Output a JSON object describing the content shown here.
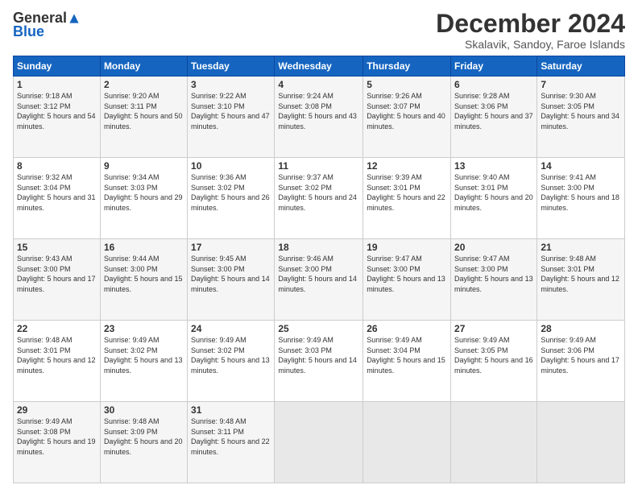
{
  "logo": {
    "general": "General",
    "blue": "Blue"
  },
  "title": "December 2024",
  "subtitle": "Skalavik, Sandoy, Faroe Islands",
  "days_of_week": [
    "Sunday",
    "Monday",
    "Tuesday",
    "Wednesday",
    "Thursday",
    "Friday",
    "Saturday"
  ],
  "weeks": [
    [
      {
        "day": "1",
        "sunrise": "9:18 AM",
        "sunset": "3:12 PM",
        "daylight": "5 hours and 54 minutes."
      },
      {
        "day": "2",
        "sunrise": "9:20 AM",
        "sunset": "3:11 PM",
        "daylight": "5 hours and 50 minutes."
      },
      {
        "day": "3",
        "sunrise": "9:22 AM",
        "sunset": "3:10 PM",
        "daylight": "5 hours and 47 minutes."
      },
      {
        "day": "4",
        "sunrise": "9:24 AM",
        "sunset": "3:08 PM",
        "daylight": "5 hours and 43 minutes."
      },
      {
        "day": "5",
        "sunrise": "9:26 AM",
        "sunset": "3:07 PM",
        "daylight": "5 hours and 40 minutes."
      },
      {
        "day": "6",
        "sunrise": "9:28 AM",
        "sunset": "3:06 PM",
        "daylight": "5 hours and 37 minutes."
      },
      {
        "day": "7",
        "sunrise": "9:30 AM",
        "sunset": "3:05 PM",
        "daylight": "5 hours and 34 minutes."
      }
    ],
    [
      {
        "day": "8",
        "sunrise": "9:32 AM",
        "sunset": "3:04 PM",
        "daylight": "5 hours and 31 minutes."
      },
      {
        "day": "9",
        "sunrise": "9:34 AM",
        "sunset": "3:03 PM",
        "daylight": "5 hours and 29 minutes."
      },
      {
        "day": "10",
        "sunrise": "9:36 AM",
        "sunset": "3:02 PM",
        "daylight": "5 hours and 26 minutes."
      },
      {
        "day": "11",
        "sunrise": "9:37 AM",
        "sunset": "3:02 PM",
        "daylight": "5 hours and 24 minutes."
      },
      {
        "day": "12",
        "sunrise": "9:39 AM",
        "sunset": "3:01 PM",
        "daylight": "5 hours and 22 minutes."
      },
      {
        "day": "13",
        "sunrise": "9:40 AM",
        "sunset": "3:01 PM",
        "daylight": "5 hours and 20 minutes."
      },
      {
        "day": "14",
        "sunrise": "9:41 AM",
        "sunset": "3:00 PM",
        "daylight": "5 hours and 18 minutes."
      }
    ],
    [
      {
        "day": "15",
        "sunrise": "9:43 AM",
        "sunset": "3:00 PM",
        "daylight": "5 hours and 17 minutes."
      },
      {
        "day": "16",
        "sunrise": "9:44 AM",
        "sunset": "3:00 PM",
        "daylight": "5 hours and 15 minutes."
      },
      {
        "day": "17",
        "sunrise": "9:45 AM",
        "sunset": "3:00 PM",
        "daylight": "5 hours and 14 minutes."
      },
      {
        "day": "18",
        "sunrise": "9:46 AM",
        "sunset": "3:00 PM",
        "daylight": "5 hours and 14 minutes."
      },
      {
        "day": "19",
        "sunrise": "9:47 AM",
        "sunset": "3:00 PM",
        "daylight": "5 hours and 13 minutes."
      },
      {
        "day": "20",
        "sunrise": "9:47 AM",
        "sunset": "3:00 PM",
        "daylight": "5 hours and 13 minutes."
      },
      {
        "day": "21",
        "sunrise": "9:48 AM",
        "sunset": "3:01 PM",
        "daylight": "5 hours and 12 minutes."
      }
    ],
    [
      {
        "day": "22",
        "sunrise": "9:48 AM",
        "sunset": "3:01 PM",
        "daylight": "5 hours and 12 minutes."
      },
      {
        "day": "23",
        "sunrise": "9:49 AM",
        "sunset": "3:02 PM",
        "daylight": "5 hours and 13 minutes."
      },
      {
        "day": "24",
        "sunrise": "9:49 AM",
        "sunset": "3:02 PM",
        "daylight": "5 hours and 13 minutes."
      },
      {
        "day": "25",
        "sunrise": "9:49 AM",
        "sunset": "3:03 PM",
        "daylight": "5 hours and 14 minutes."
      },
      {
        "day": "26",
        "sunrise": "9:49 AM",
        "sunset": "3:04 PM",
        "daylight": "5 hours and 15 minutes."
      },
      {
        "day": "27",
        "sunrise": "9:49 AM",
        "sunset": "3:05 PM",
        "daylight": "5 hours and 16 minutes."
      },
      {
        "day": "28",
        "sunrise": "9:49 AM",
        "sunset": "3:06 PM",
        "daylight": "5 hours and 17 minutes."
      }
    ],
    [
      {
        "day": "29",
        "sunrise": "9:49 AM",
        "sunset": "3:08 PM",
        "daylight": "5 hours and 19 minutes."
      },
      {
        "day": "30",
        "sunrise": "9:48 AM",
        "sunset": "3:09 PM",
        "daylight": "5 hours and 20 minutes."
      },
      {
        "day": "31",
        "sunrise": "9:48 AM",
        "sunset": "3:11 PM",
        "daylight": "5 hours and 22 minutes."
      },
      null,
      null,
      null,
      null
    ]
  ]
}
